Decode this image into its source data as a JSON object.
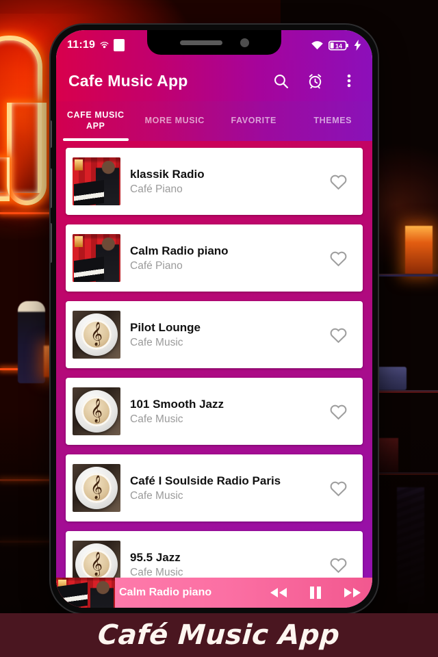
{
  "status_bar": {
    "time": "11:19",
    "signal_icon": "broadcast-icon",
    "wifi_icon": "wifi-icon",
    "battery_level": "14",
    "charging_icon": "charging-bolt-icon"
  },
  "appbar": {
    "title": "Cafe Music App",
    "search_icon": "search-icon",
    "timer_icon": "alarm-clock-icon",
    "overflow_icon": "more-vertical-icon"
  },
  "tabs": [
    {
      "label": "CAFE MUSIC APP",
      "active": true
    },
    {
      "label": "MORE MUSIC",
      "active": false
    },
    {
      "label": "FAVORITE",
      "active": false
    },
    {
      "label": "THEMES",
      "active": false
    }
  ],
  "stations": [
    {
      "title": "klassik Radio",
      "subtitle": "Café Piano",
      "thumb": "piano",
      "fav_icon": "heart-outline-icon"
    },
    {
      "title": "Calm Radio piano",
      "subtitle": "Café Piano",
      "thumb": "piano",
      "fav_icon": "heart-outline-icon"
    },
    {
      "title": "Pilot Lounge",
      "subtitle": "Cafe Music",
      "thumb": "coffee",
      "fav_icon": "heart-outline-icon"
    },
    {
      "title": "101 Smooth Jazz",
      "subtitle": "Cafe Music",
      "thumb": "coffee",
      "fav_icon": "heart-outline-icon"
    },
    {
      "title": "Café I Soulside Radio Paris",
      "subtitle": "Cafe Music",
      "thumb": "coffee",
      "fav_icon": "heart-outline-icon"
    },
    {
      "title": "95.5 Jazz",
      "subtitle": "Cafe Music",
      "thumb": "coffee",
      "fav_icon": "heart-outline-icon"
    }
  ],
  "player": {
    "now_playing": "Calm Radio piano",
    "prev_icon": "skip-previous-icon",
    "pause_icon": "pause-icon",
    "next_icon": "skip-next-icon"
  },
  "banner": {
    "text": "Café Music App"
  },
  "colors": {
    "accent_start": "#d8004c",
    "accent_end": "#8c0fba",
    "player_bar": "#fb6fa3",
    "banner_bg": "#4a1620",
    "card_bg": "#ffffff",
    "subtitle": "#9a9a9a"
  }
}
